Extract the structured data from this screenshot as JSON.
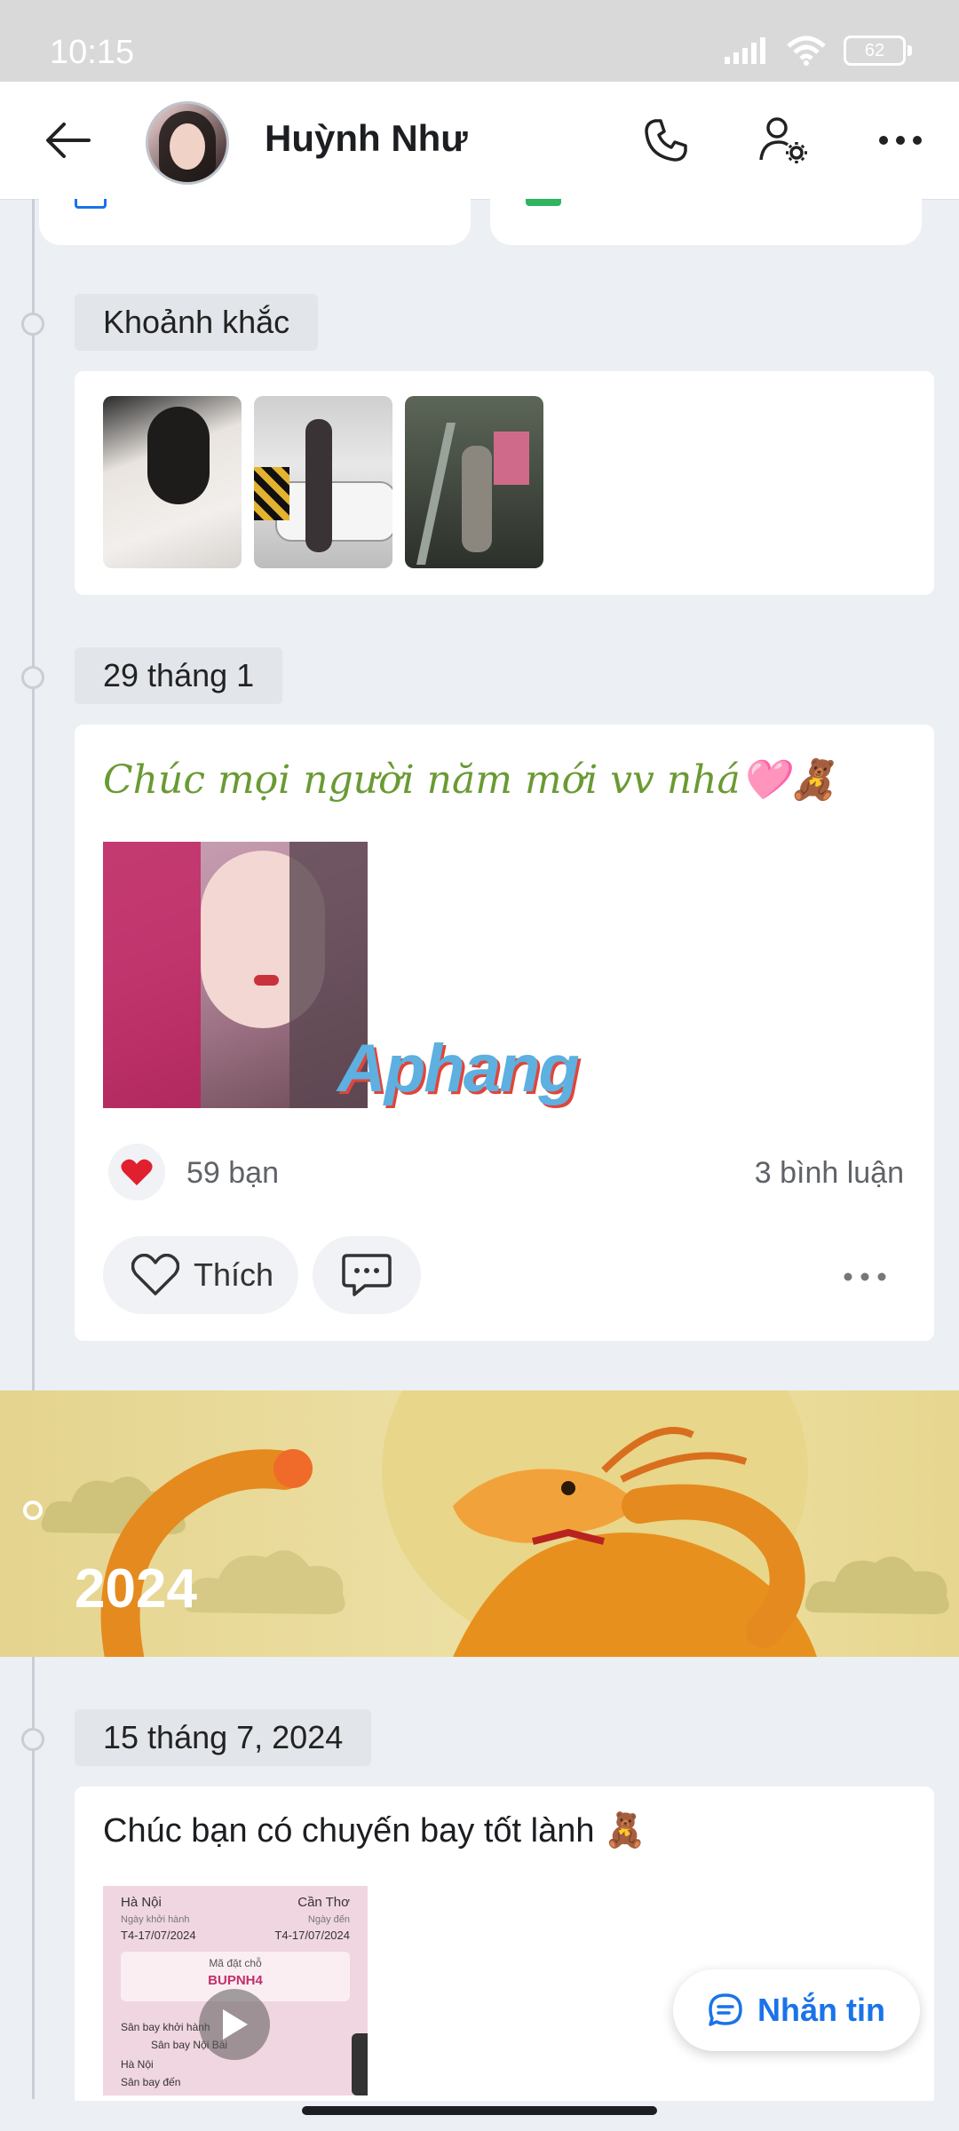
{
  "status_bar": {
    "time": "10:15",
    "battery": "62"
  },
  "header": {
    "title": "Huỳnh Như"
  },
  "moments": {
    "label": "Khoảnh khắc"
  },
  "posts": [
    {
      "date": "29 tháng 1",
      "text": "Chúc mọi người năm mới vv nhá🩷🧸",
      "watermark": "Aphang",
      "likes": "59 bạn",
      "comments": "3 bình luận",
      "like_label": "Thích"
    },
    {
      "date": "15 tháng 7, 2024",
      "text": "Chúc bạn có chuyến bay tốt lành 🧸",
      "ticket": {
        "from": "Hà Nội",
        "to": "Cần Thơ",
        "depart_label": "Ngày khởi hành",
        "arrive_label": "Ngày đến",
        "depart_date": "T4-17/07/2024",
        "arrive_date": "T4-17/07/2024",
        "code_label": "Mã đặt chỗ",
        "code": "BUPNH4",
        "airport_depart": "Sân bay khởi hành",
        "airport_name": "Sân bay Nội Bài",
        "city": "Hà Nội",
        "airport_arrive": "Sân bay đến"
      }
    }
  ],
  "year_banner": {
    "year": "2024"
  },
  "message_button": {
    "label": "Nhắn tin"
  }
}
